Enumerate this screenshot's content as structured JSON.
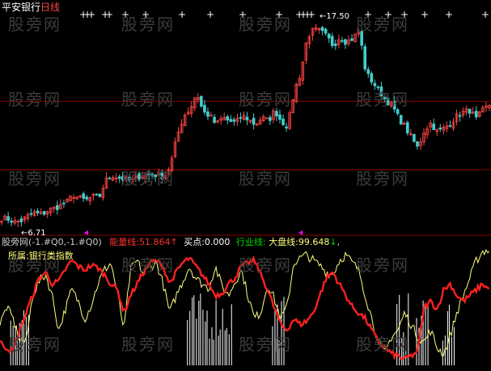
{
  "top_title": {
    "stock": "平安银行",
    "period": "日线"
  },
  "watermark": "股旁网",
  "price_labels": {
    "high": "17.50",
    "low": "6.71"
  },
  "indicator_bar": {
    "name": "股旁网",
    "params": "(-1.#Q0,-1.#Q0)",
    "energy_label": "能量线:",
    "energy_value": "51.864",
    "energy_arrow": "↑",
    "buy_label": "买点:",
    "buy_value": "0.000",
    "industry_label": "行业线:",
    "market_label": "大盘线:",
    "market_value": "99.648",
    "market_arrow": "↓",
    "tail": ","
  },
  "sector_label": "所属:",
  "sector_value": "银行类指数",
  "colors": {
    "background": "#000000",
    "up": "#ff4444",
    "down": "#44cccc",
    "energy": "#ff2020",
    "market": "#ffff80",
    "industry": "#00dd00",
    "buy_marks": "#ffffff",
    "ref_lines": "#8b0000",
    "arrow_mark": "#ff00ff"
  },
  "chart_data": [
    {
      "type": "candlestick",
      "title": "平安银行 日线",
      "low_label": 6.71,
      "high_label": 17.5,
      "ylim": [
        6.0,
        18.5
      ],
      "ref_lines": [
        13.4,
        9.6
      ],
      "y": [
        6.9,
        6.85,
        6.7,
        6.75,
        7.0,
        7.2,
        7.1,
        7.3,
        7.45,
        7.6,
        7.8,
        8.2,
        8.0,
        7.9,
        8.1,
        8.05,
        9.0,
        9.3,
        9.15,
        9.05,
        9.0,
        9.2,
        9.3,
        9.25,
        9.35,
        9.2,
        9.9,
        11.5,
        12.6,
        13.0,
        13.9,
        12.8,
        12.6,
        12.1,
        12.5,
        12.3,
        12.2,
        12.6,
        12.4,
        12.1,
        12.5,
        12.3,
        12.9,
        12.3,
        12.0,
        14.0,
        15.0,
        17.0,
        17.4,
        17.3,
        17.0,
        16.5,
        17.0,
        16.7,
        16.9,
        17.3,
        15.0,
        14.5,
        14.0,
        13.5,
        13.2,
        12.5,
        12.0,
        11.4,
        10.8,
        11.8,
        12.2,
        11.7,
        11.9,
        12.2,
        12.6,
        12.8,
        12.9,
        12.4,
        12.9,
        13.2
      ]
    },
    {
      "type": "line",
      "title": "股旁网",
      "series": [
        {
          "name": "能量线",
          "values": [
            20,
            15,
            12,
            30,
            45,
            60,
            75,
            80,
            70,
            72,
            82,
            90,
            85,
            82,
            86,
            84,
            78,
            70,
            65,
            45,
            60,
            70,
            80,
            88,
            90,
            85,
            70,
            80,
            88,
            92,
            85,
            78,
            70,
            60,
            62,
            70,
            75,
            85,
            88,
            90,
            78,
            65,
            50,
            35,
            30,
            40,
            35,
            38,
            45,
            60,
            75,
            80,
            70,
            60,
            50,
            45,
            40,
            30,
            20,
            15,
            10,
            8,
            5,
            8,
            12,
            50,
            55,
            48,
            65,
            70,
            60,
            55,
            60,
            65,
            70,
            65
          ]
        },
        {
          "name": "大盘线",
          "values": [
            35,
            50,
            40,
            22,
            20,
            60,
            72,
            78,
            60,
            30,
            48,
            65,
            55,
            40,
            52,
            70,
            82,
            88,
            62,
            30,
            82,
            90,
            78,
            85,
            88,
            70,
            45,
            60,
            72,
            85,
            75,
            70,
            66,
            85,
            68,
            60,
            72,
            82,
            60,
            40,
            46,
            70,
            58,
            40,
            50,
            88,
            92,
            95,
            90,
            86,
            80,
            78,
            90,
            95,
            88,
            82,
            60,
            40,
            20,
            10,
            25,
            30,
            45,
            35,
            25,
            20,
            30,
            15,
            10,
            25,
            45,
            60,
            75,
            90,
            98,
            99
          ]
        }
      ],
      "buy_signals": [
        2,
        3,
        4,
        29,
        30,
        31,
        32,
        33,
        34,
        35,
        42,
        43,
        61,
        62,
        64,
        65,
        68,
        69
      ],
      "ylim": [
        0,
        100
      ]
    }
  ]
}
